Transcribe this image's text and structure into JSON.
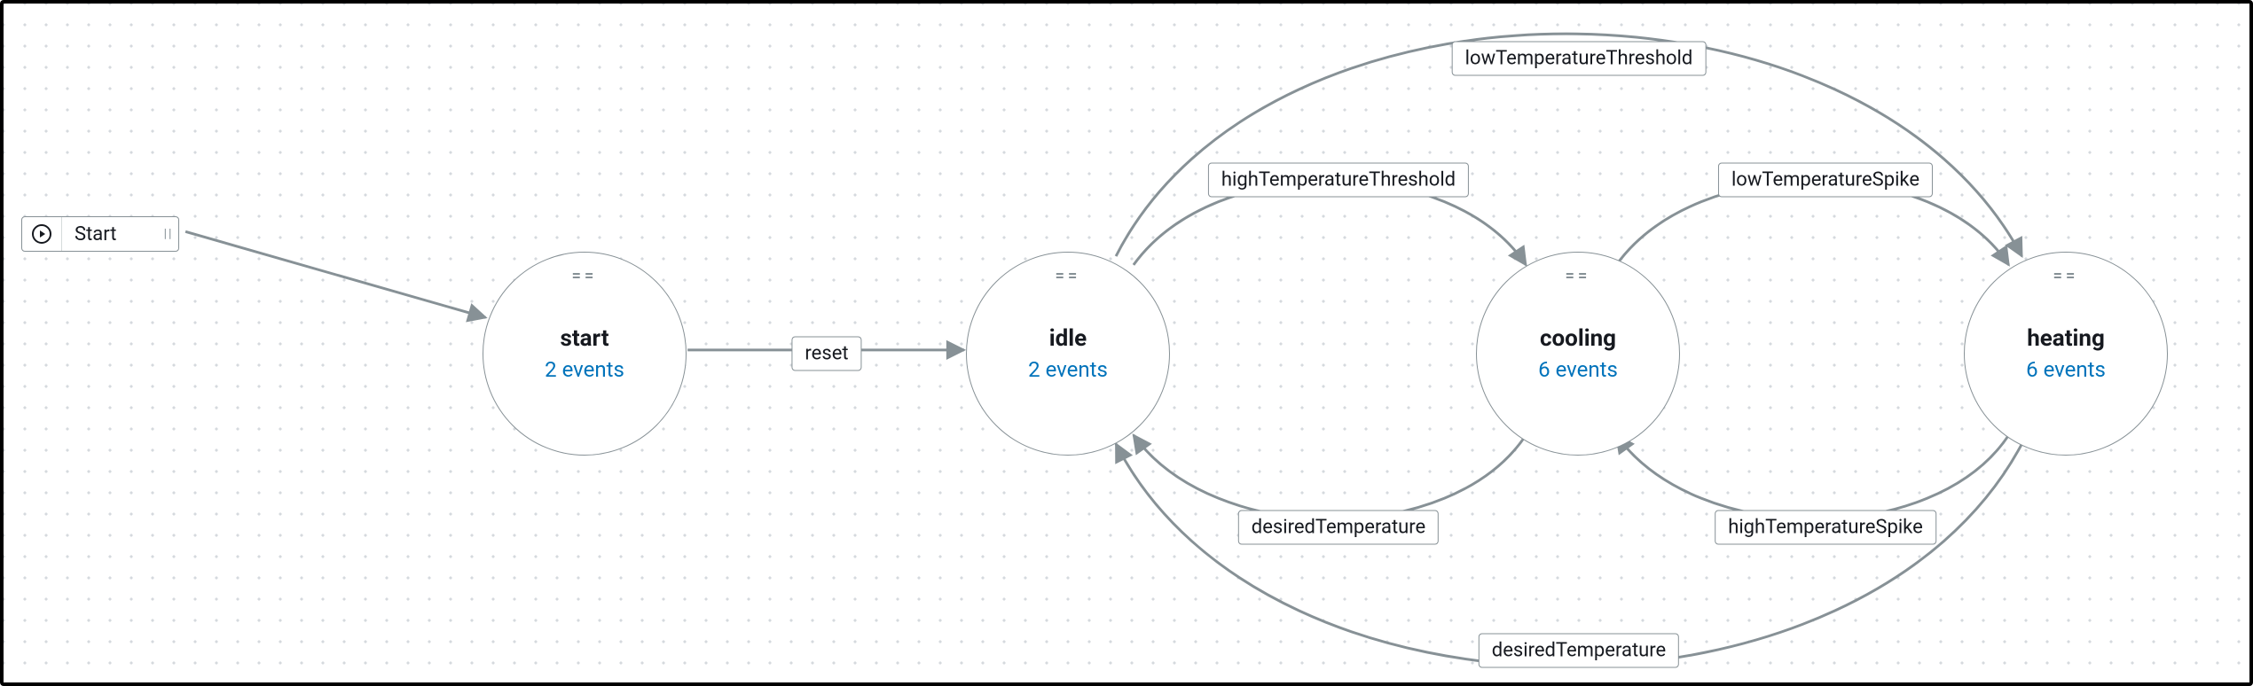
{
  "start_node": {
    "label": "Start"
  },
  "states": [
    {
      "id": "start",
      "name": "start",
      "events_label": "2 events"
    },
    {
      "id": "idle",
      "name": "idle",
      "events_label": "2 events"
    },
    {
      "id": "cooling",
      "name": "cooling",
      "events_label": "6 events"
    },
    {
      "id": "heating",
      "name": "heating",
      "events_label": "6 events"
    }
  ],
  "transitions": {
    "reset": "reset",
    "highTemperatureThreshold": "highTemperatureThreshold",
    "lowTemperatureThreshold": "lowTemperatureThreshold",
    "lowTemperatureSpike": "lowTemperatureSpike",
    "highTemperatureSpike": "highTemperatureSpike",
    "desiredTemperature_cooling": "desiredTemperature",
    "desiredTemperature_heating": "desiredTemperature"
  },
  "colors": {
    "link": "#0073bb",
    "edge": "#879196"
  }
}
